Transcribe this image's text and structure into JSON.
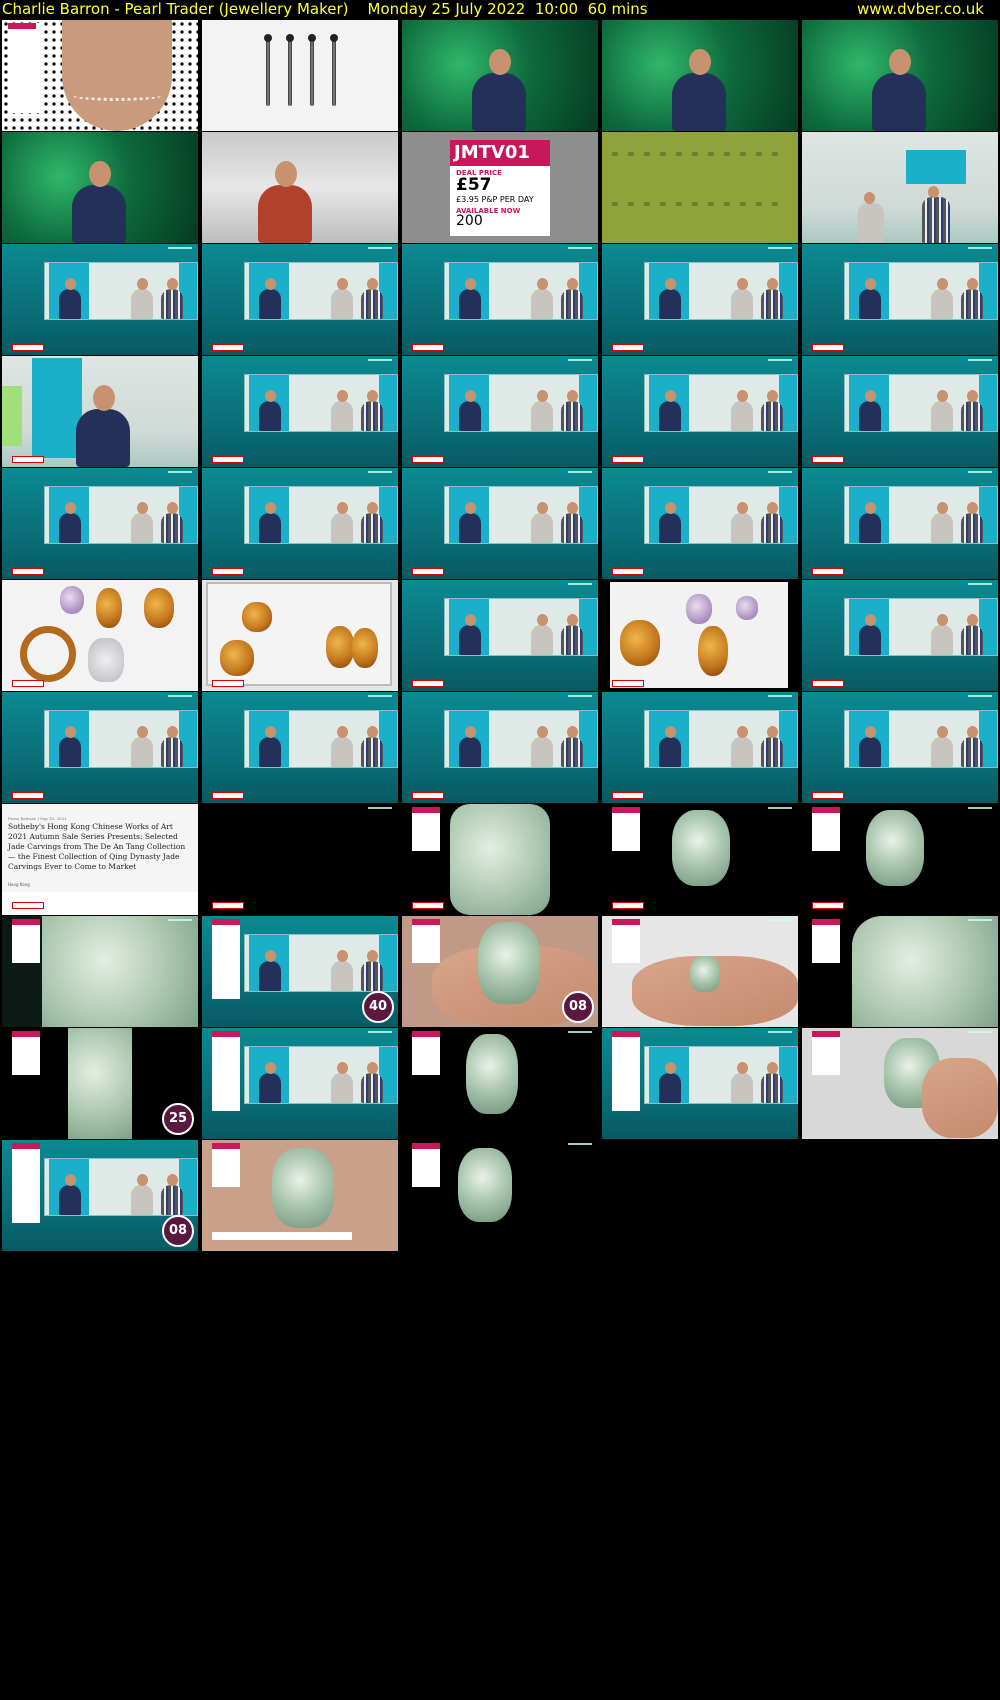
{
  "header": {
    "title": "Charlie Barron - Pearl Trader (Jewellery Maker)    Monday 25 July 2022  10:00  60 mins",
    "url": "www.dvber.co.uk"
  },
  "colors": {
    "header_text": "#ffff33",
    "background": "#000000",
    "accent": "#c8185b",
    "teal": "#0a7d86"
  },
  "promo_card": {
    "code": "JMTV01",
    "deal_label": "DEAL PRICE",
    "price": "£57",
    "postage": "£3.95 P&P PER DAY",
    "available_label": "AVAILABLE NOW",
    "available_count": "200"
  },
  "article": {
    "date": "Press Release | Sep 30, 2021",
    "headline": "Sotheby's Hong Kong Chinese Works of Art 2021 Autumn Sale Series Presents: Selected Jade Carvings from The De An Tang Collection — the Finest Collection of Qing Dynasty Jade Carvings Ever to Come to Market",
    "place": "Hong Kong"
  },
  "badges": [
    "40",
    "08",
    "25",
    "08"
  ]
}
